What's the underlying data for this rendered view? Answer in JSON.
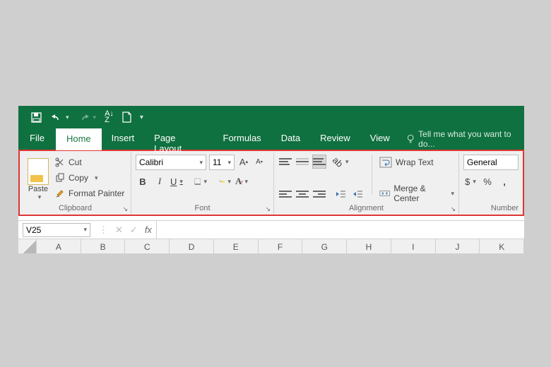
{
  "qat": {
    "save": "save",
    "undo": "undo",
    "redo": "redo",
    "sort": "sort",
    "newfile": "new",
    "custom": "custom"
  },
  "tabs": {
    "file": "File",
    "home": "Home",
    "insert": "Insert",
    "pagelayout": "Page Layout",
    "formulas": "Formulas",
    "data": "Data",
    "review": "Review",
    "view": "View",
    "tell": "Tell me what you want to do..."
  },
  "clipboard": {
    "paste": "Paste",
    "cut": "Cut",
    "copy": "Copy",
    "fmtpainter": "Format Painter",
    "label": "Clipboard"
  },
  "font": {
    "name": "Calibri",
    "size": "11",
    "label": "Font",
    "bold": "B",
    "italic": "I",
    "underline": "U",
    "growA": "A",
    "shrinkA": "A"
  },
  "alignment": {
    "wrap": "Wrap Text",
    "merge": "Merge & Center",
    "label": "Alignment"
  },
  "number": {
    "format": "General",
    "label": "Number",
    "currency": "$",
    "percent": "%",
    "comma": ","
  },
  "formula": {
    "cell": "V25",
    "fx": "fx"
  },
  "columns": [
    "A",
    "B",
    "C",
    "D",
    "E",
    "F",
    "G",
    "H",
    "I",
    "J",
    "K"
  ]
}
